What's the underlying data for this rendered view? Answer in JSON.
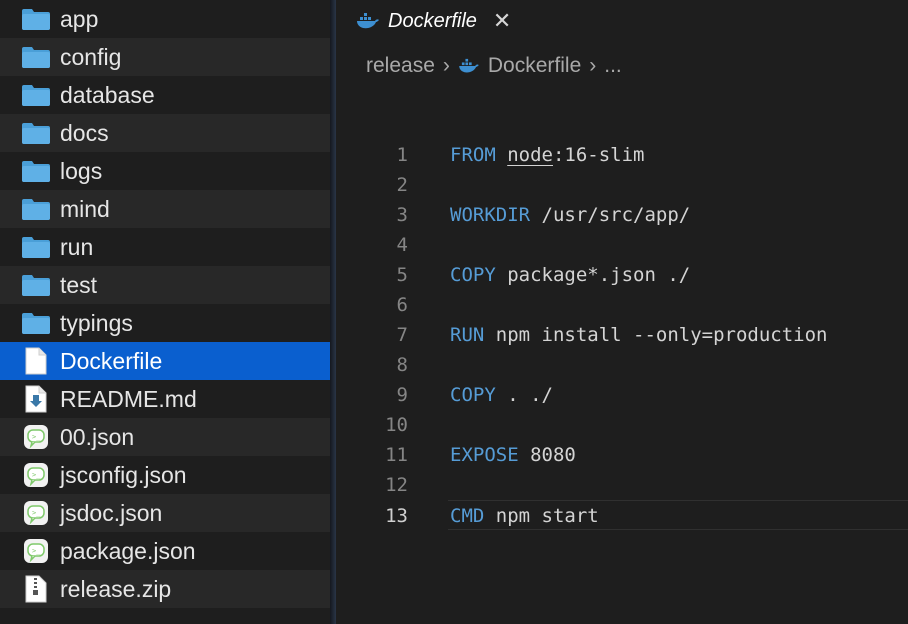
{
  "sidebar": {
    "items": [
      {
        "label": "app",
        "icon": "folder-icon",
        "kind": "folder"
      },
      {
        "label": "config",
        "icon": "folder-icon",
        "kind": "folder"
      },
      {
        "label": "database",
        "icon": "folder-icon",
        "kind": "folder"
      },
      {
        "label": "docs",
        "icon": "folder-icon",
        "kind": "folder"
      },
      {
        "label": "logs",
        "icon": "folder-icon",
        "kind": "folder"
      },
      {
        "label": "mind",
        "icon": "folder-icon",
        "kind": "folder"
      },
      {
        "label": "run",
        "icon": "folder-icon",
        "kind": "folder"
      },
      {
        "label": "test",
        "icon": "folder-icon",
        "kind": "folder"
      },
      {
        "label": "typings",
        "icon": "folder-icon",
        "kind": "folder"
      },
      {
        "label": "Dockerfile",
        "icon": "document-icon",
        "kind": "file",
        "selected": true
      },
      {
        "label": "README.md",
        "icon": "markdown-file-icon",
        "kind": "file"
      },
      {
        "label": "00.json",
        "icon": "json-file-icon",
        "kind": "file"
      },
      {
        "label": "jsconfig.json",
        "icon": "json-file-icon",
        "kind": "file"
      },
      {
        "label": "jsdoc.json",
        "icon": "json-file-icon",
        "kind": "file"
      },
      {
        "label": "package.json",
        "icon": "json-file-icon",
        "kind": "file"
      },
      {
        "label": "release.zip",
        "icon": "zip-file-icon",
        "kind": "file"
      }
    ]
  },
  "editor": {
    "tab": {
      "title": "Dockerfile",
      "close": "✕"
    },
    "breadcrumb": {
      "folder": "release",
      "file": "Dockerfile",
      "more": "...",
      "sep": "›"
    },
    "lines": [
      {
        "num": "1",
        "kw": "FROM",
        "rest": ":16-slim",
        "ref": "node"
      },
      {
        "num": "2",
        "kw": "",
        "rest": ""
      },
      {
        "num": "3",
        "kw": "WORKDIR",
        "rest": " /usr/src/app/"
      },
      {
        "num": "4",
        "kw": "",
        "rest": ""
      },
      {
        "num": "5",
        "kw": "COPY",
        "rest": " package*.json ./"
      },
      {
        "num": "6",
        "kw": "",
        "rest": ""
      },
      {
        "num": "7",
        "kw": "RUN",
        "rest": " npm install --only=production"
      },
      {
        "num": "8",
        "kw": "",
        "rest": ""
      },
      {
        "num": "9",
        "kw": "COPY",
        "rest": " . ./"
      },
      {
        "num": "10",
        "kw": "",
        "rest": ""
      },
      {
        "num": "11",
        "kw": "EXPOSE",
        "rest": " 8080"
      },
      {
        "num": "12",
        "kw": "",
        "rest": ""
      },
      {
        "num": "13",
        "kw": "CMD",
        "rest": " npm start",
        "current": true
      }
    ]
  },
  "colors": {
    "selection": "#0a5fcf",
    "keyword": "#569cd6",
    "folder": "#4a9fd8",
    "background": "#1e1e1e"
  }
}
